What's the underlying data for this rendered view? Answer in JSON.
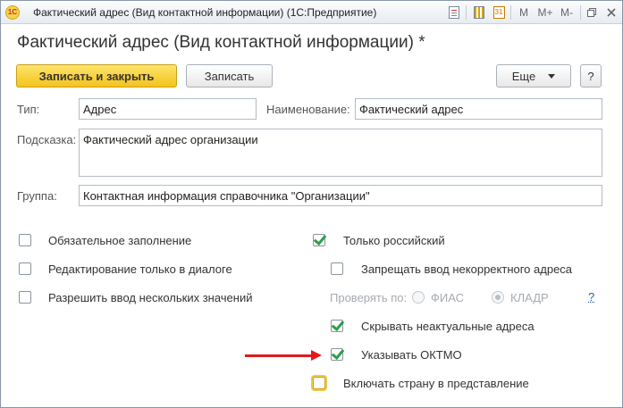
{
  "window": {
    "title": "Фактический адрес (Вид контактной информации)  (1С:Предприятие)",
    "logo": "1С",
    "toolbar_icons": [
      "document-icon",
      "calculator-icon",
      "calendar-icon",
      "memory-m-icon",
      "memory-m-plus-icon",
      "memory-m-minus-icon"
    ],
    "m_labels": [
      "M",
      "M+",
      "M-"
    ],
    "cal_text": "31"
  },
  "page": {
    "title": "Фактический адрес (Вид контактной информации) *"
  },
  "actions": {
    "save_close": "Записать и закрыть",
    "save": "Записать",
    "more": "Еще",
    "help": "?"
  },
  "form": {
    "type_label": "Тип:",
    "type_value": "Адрес",
    "name_label": "Наименование:",
    "name_value": "Фактический адрес",
    "hint_label": "Подсказка:",
    "hint_value": "Фактический адрес организации",
    "group_label": "Группа:",
    "group_value": "Контактная информация справочника \"Организации\""
  },
  "options_left": [
    {
      "label": "Обязательное заполнение",
      "checked": false
    },
    {
      "label": "Редактирование только в диалоге",
      "checked": false
    },
    {
      "label": "Разрешить ввод нескольких значений",
      "checked": false
    }
  ],
  "options_right": {
    "russian_only": {
      "label": "Только российский",
      "checked": true
    },
    "forbid_incorrect": {
      "label": "Запрещать ввод некорректного адреса",
      "checked": false
    },
    "check_by_label": "Проверять по:",
    "radio_fias": "ФИАС",
    "radio_kladr": "КЛАДР",
    "check_by_selected": "КЛАДР",
    "help_link": "?",
    "hide_obsolete": {
      "label": "Скрывать неактуальные адреса",
      "checked": true
    },
    "show_oktmo": {
      "label": "Указывать ОКТМО",
      "checked": true
    },
    "include_country": {
      "label": "Включать страну в представление",
      "checked": false
    }
  },
  "colors": {
    "primary_button": "#f4c31d",
    "check_mark": "#2e9e48",
    "annotation_arrow": "#e01b1b",
    "link": "#2a5db0"
  }
}
